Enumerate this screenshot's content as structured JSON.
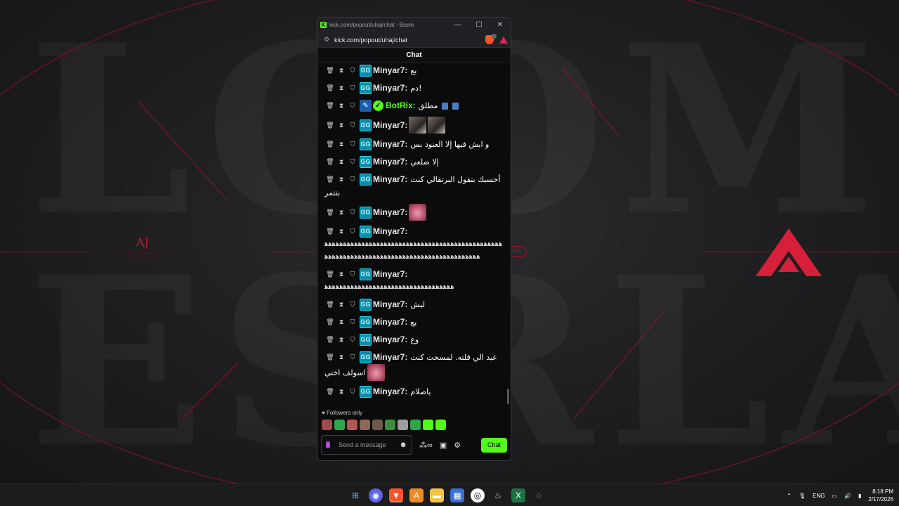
{
  "browser": {
    "title": "kick.com/popout/uhaj/chat - Brave",
    "url": "kick.com/popout/uhaj/chat",
    "minimize_icon": "minimize-icon",
    "maximize_icon": "maximize-icon",
    "close_icon": "close-icon"
  },
  "wallpaper": {
    "row1_letters": "LCOME",
    "row2_letters": "ESRLA",
    "logo_text": "AJ",
    "accent_color": "#c2182f"
  },
  "chat": {
    "header": "Chat",
    "messages": [
      {
        "user": "Minyar7:",
        "text": "يع",
        "emotes": []
      },
      {
        "user": "Minyar7:",
        "text": "دم!",
        "emotes": []
      },
      {
        "user": "BotRix:",
        "text": "مطلق",
        "bot": true,
        "emotes": [
          "blue",
          "blue"
        ]
      },
      {
        "user": "Minyar7:",
        "text": "",
        "emotes": [
          "face",
          "face"
        ]
      },
      {
        "user": "Minyar7:",
        "text": "و ايش فيها إلا العنود بس",
        "emotes": []
      },
      {
        "user": "Minyar7:",
        "text": "إلا ضلعي",
        "emotes": []
      },
      {
        "user": "Minyar7:",
        "text": "أحسبك بتقول البرتقالي كنت",
        "cont": "بتتمر",
        "emotes": []
      },
      {
        "user": "Minyar7:",
        "text": "",
        "emotes": [
          "pink"
        ]
      },
      {
        "user": "Minyar7:",
        "text": "",
        "long": "ﻫﻫﻫﻫﻫﻫﻫﻫﻫﻫﻫﻫﻫﻫﻫﻫﻫﻫﻫﻫﻫﻫﻫﻫﻫﻫﻫﻫﻫﻫﻫﻫﻫﻫﻫﻫﻫﻫﻫﻫﻫﻫﻫﻫﻫﻫﻫﻫﻫﻫﻫﻫﻫﻫﻫﻫﻫﻫﻫﻫﻫﻫﻫﻫﻫﻫﻫﻫﻫﻫﻫﻫﻫﻫﻫﻫﻫﻫﻫﻫﻫﻫﻫﻫﻫﻫﻫﻫﻫﻫ",
        "emotes": []
      },
      {
        "user": "Minyar7:",
        "text": "",
        "long": "ﻫﻫﻫﻫﻫﻫﻫﻫﻫﻫﻫﻫﻫﻫﻫﻫﻫﻫﻫﻫﻫﻫﻫﻫﻫﻫﻫﻫﻫﻫﻫﻫﻫﻫﻫ",
        "emotes": []
      },
      {
        "user": "Minyar7:",
        "text": "ليش",
        "emotes": []
      },
      {
        "user": "Minyar7:",
        "text": "يع",
        "emotes": []
      },
      {
        "user": "Minyar7:",
        "text": "وع",
        "emotes": []
      },
      {
        "user": "Minyar7:",
        "text": "عيد الي قلته. لمسحت كنت",
        "cont": "اسولف اختي",
        "cont_emote": "pink",
        "emotes": []
      },
      {
        "user": "Minyar7:",
        "text": "ياصلام",
        "emotes": []
      }
    ],
    "followers_only": "Followers only",
    "input_placeholder": "Send a message",
    "send_label": "Chat",
    "infinity": "∞"
  },
  "taskbar": {
    "language": "ENG",
    "time": "8:18 PM",
    "date": "2/17/2026"
  }
}
